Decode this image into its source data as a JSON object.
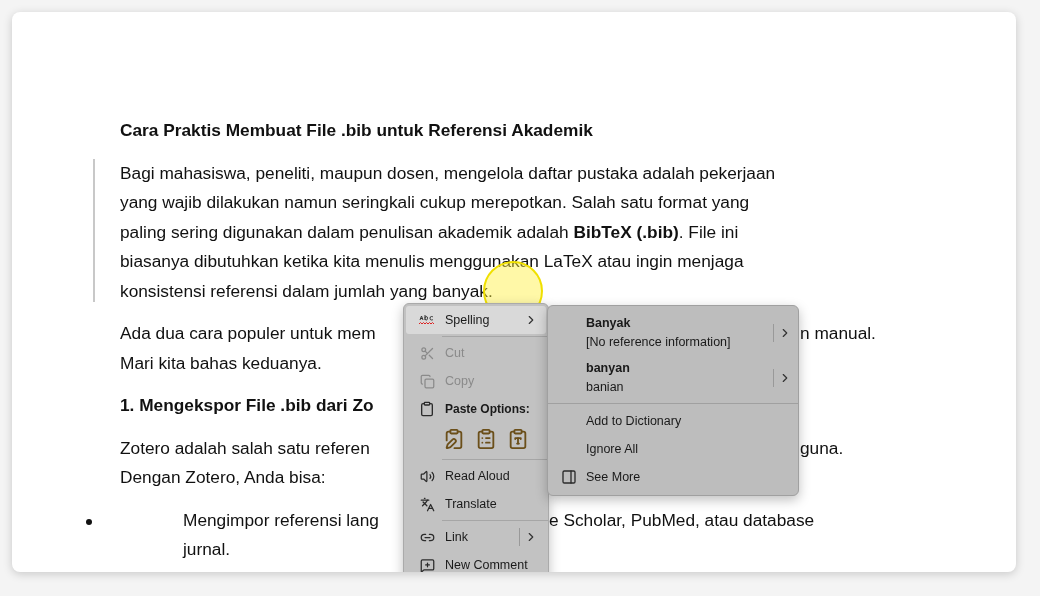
{
  "document": {
    "blocks": [
      {
        "kind": "heading",
        "lines": [
          {
            "text": "Cara Praktis Membuat File .bib untuk Referensi Akademik"
          }
        ]
      },
      {
        "kind": "paragraph",
        "revision_bar": true,
        "lines": [
          {
            "text": "Bagi mahasiswa, peneliti, maupun dosen, mengelola daftar pustaka adalah pekerjaan"
          },
          {
            "text": "yang wajib dilakukan namun seringkali cukup merepotkan. Salah satu format yang"
          },
          {
            "text": "paling sering digunakan dalam penulisan akademik adalah **BibTeX (.bib)**. File ini"
          },
          {
            "text": "biasanya dibutuhkan ketika kita menulis menggunakan LaTeX atau ingin menjaga"
          },
          {
            "text": "konsistensi referensi dalam jumlah yang banyak."
          }
        ]
      },
      {
        "kind": "paragraph",
        "revision_bar": false,
        "lines": [
          {
            "text": "Ada dua cara populer untuk mem",
            "tail": {
              "kind": "submenu",
              "text": "n manual."
            }
          },
          {
            "text": "Mari kita bahas keduanya."
          }
        ]
      },
      {
        "kind": "heading",
        "lines": [
          {
            "text": "1. Mengekspor File .bib dari Zo"
          }
        ]
      },
      {
        "kind": "paragraph",
        "revision_bar": false,
        "lines": [
          {
            "text": "Zotero adalah salah satu referen",
            "tail": {
              "kind": "submenu",
              "text": "guna."
            }
          },
          {
            "text": "Dengan Zotero, Anda bisa:"
          }
        ]
      },
      {
        "kind": "bullet",
        "lines": [
          {
            "text": "Mengimpor referensi lang",
            "tail": {
              "kind": "menu",
              "text": "e Scholar, PubMed, atau database"
            }
          },
          {
            "text": "jurnal."
          }
        ]
      }
    ]
  },
  "context_menu": {
    "items": [
      {
        "kind": "item",
        "label": "Spelling",
        "submenu": true,
        "highlighted": true,
        "disabled": false
      },
      {
        "kind": "separator"
      },
      {
        "kind": "item",
        "label": "Cut",
        "submenu": false,
        "highlighted": false,
        "disabled": true
      },
      {
        "kind": "item",
        "label": "Copy",
        "submenu": false,
        "highlighted": false,
        "disabled": true
      },
      {
        "kind": "header",
        "label": "Paste Options:"
      },
      {
        "kind": "paste_row"
      },
      {
        "kind": "separator"
      },
      {
        "kind": "item",
        "label": "Read Aloud",
        "submenu": false,
        "highlighted": false,
        "disabled": false
      },
      {
        "kind": "item",
        "label": "Translate",
        "submenu": false,
        "highlighted": false,
        "disabled": false
      },
      {
        "kind": "separator"
      },
      {
        "kind": "item",
        "label": "Link",
        "submenu": true,
        "highlighted": false,
        "disabled": false
      },
      {
        "kind": "item",
        "label": "New Comment",
        "submenu": false,
        "highlighted": false,
        "disabled": false
      }
    ]
  },
  "spelling_submenu": {
    "items": [
      {
        "kind": "suggestion",
        "word": "Banyak",
        "detail": "[No reference information]"
      },
      {
        "kind": "suggestion",
        "word": "banyan",
        "detail": "banian"
      },
      {
        "kind": "separator"
      },
      {
        "kind": "action",
        "label": "Add to Dictionary",
        "icon": false
      },
      {
        "kind": "action",
        "label": "Ignore All",
        "icon": false
      },
      {
        "kind": "action",
        "label": "See More",
        "icon": true
      }
    ]
  }
}
